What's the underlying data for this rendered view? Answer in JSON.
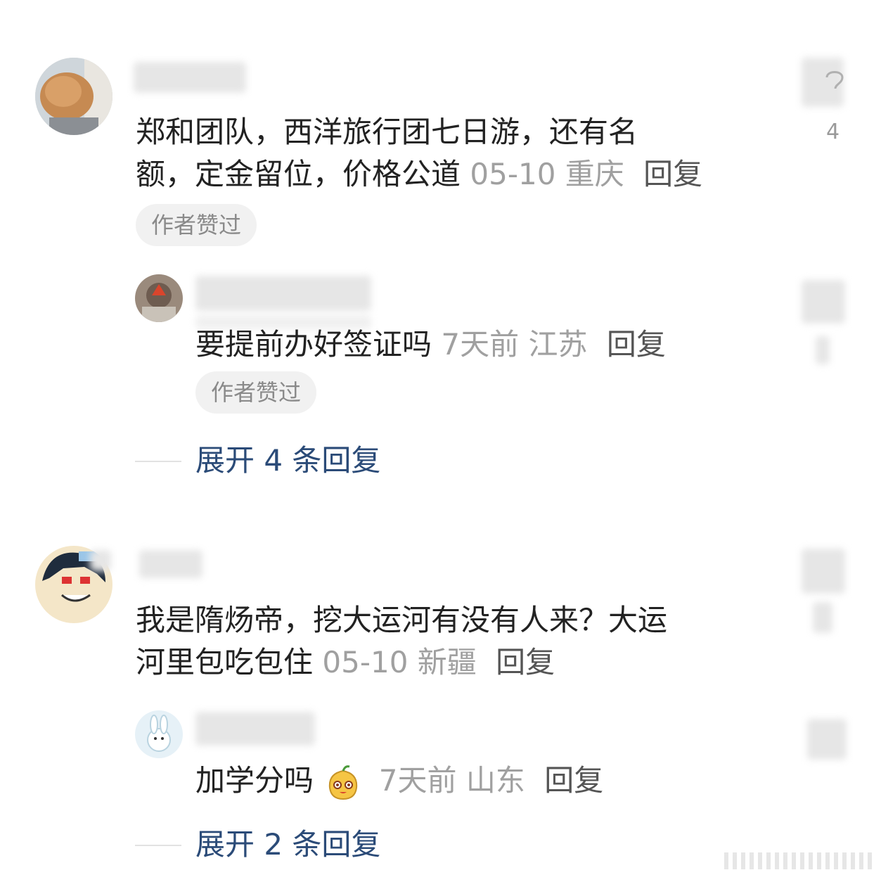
{
  "comments": [
    {
      "text_line1": "郑和团队，西洋旅行团七日游，还有名",
      "text_line2": "额，定金留位，价格公道",
      "time": "05-10",
      "location": "重庆",
      "reply_label": "回复",
      "author_liked_badge": "作者赞过",
      "likes": "4",
      "sub_reply": {
        "text": "要提前办好签证吗",
        "time": "7天前",
        "location": "江苏",
        "reply_label": "回复",
        "author_liked_badge": "作者赞过"
      },
      "expand_label": "展开 4 条回复"
    },
    {
      "text_line1": "我是隋炀帝，挖大运河有没有人来？大运",
      "text_line2": "河里包吃包住",
      "time": "05-10",
      "location": "新疆",
      "reply_label": "回复",
      "sub_reply": {
        "text": "加学分吗",
        "emoji": "face-emoji",
        "time": "7天前",
        "location": "山东",
        "reply_label": "回复"
      },
      "expand_label": "展开 2 条回复"
    }
  ],
  "colors": {
    "expand_link": "#2b4b78",
    "meta_gray": "#a0a0a0",
    "badge_bg": "#f1f1f1"
  }
}
